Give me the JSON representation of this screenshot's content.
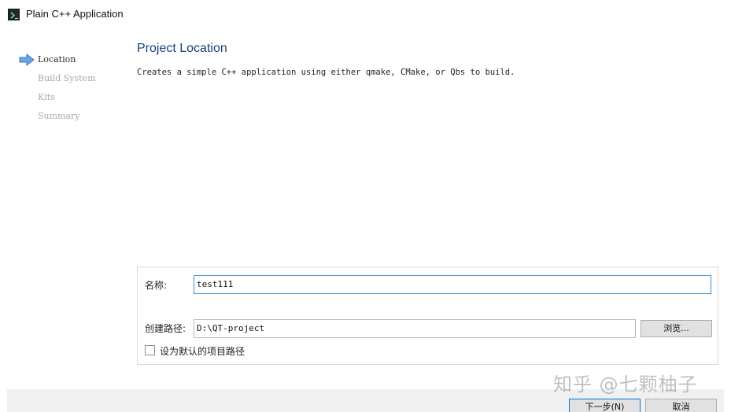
{
  "window": {
    "title": "Plain C++ Application",
    "icon": "terminal-icon"
  },
  "steps": [
    {
      "label": "Location",
      "active": true
    },
    {
      "label": "Build System",
      "active": false
    },
    {
      "label": "Kits",
      "active": false
    },
    {
      "label": "Summary",
      "active": false
    }
  ],
  "page": {
    "title": "Project Location",
    "description": "Creates a simple C++ application using either qmake, CMake, or Qbs to build."
  },
  "form": {
    "name_label": "名称:",
    "name_value": "test111",
    "path_label": "创建路径:",
    "path_value": "D:\\QT-project",
    "browse_label": "浏览...",
    "default_checkbox_label": "设为默认的项目路径",
    "default_checked": false
  },
  "buttons": {
    "next_label": "下一步(N)",
    "cancel_label": "取消"
  },
  "watermark": "知乎 @七颗柚子",
  "colors": {
    "accent": "#3a8fd6",
    "title": "#1a3f7a",
    "arrow": "#4a90d9"
  }
}
